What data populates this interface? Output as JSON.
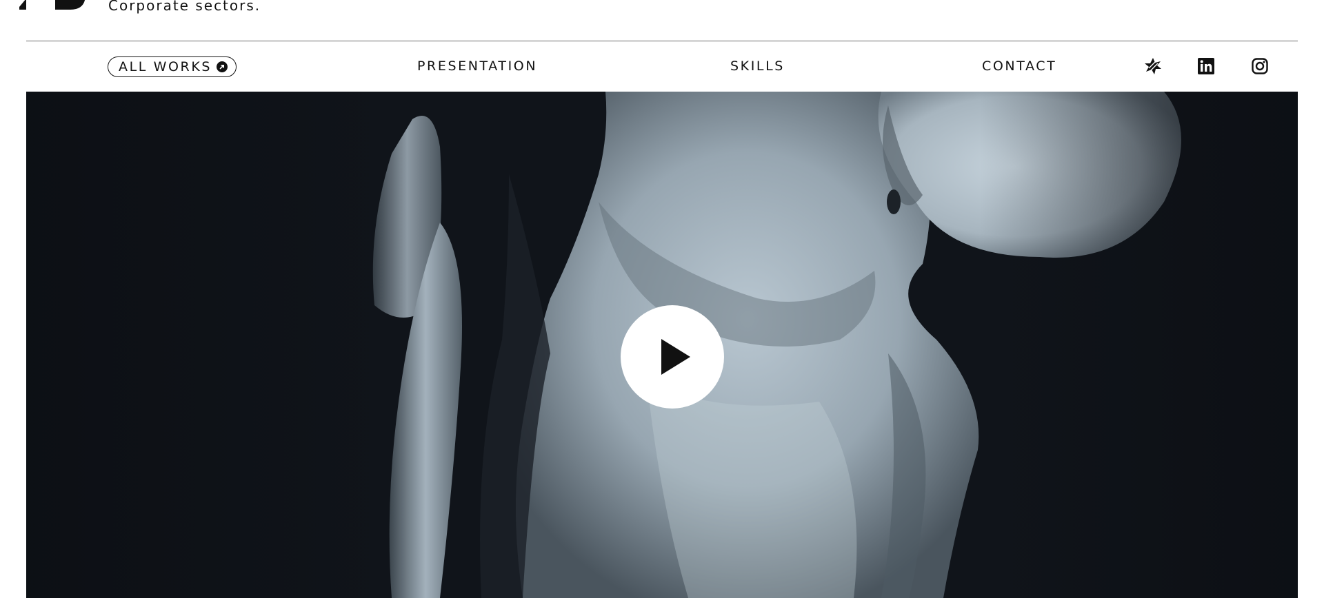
{
  "header": {
    "tagline": "Corporate sectors."
  },
  "nav": {
    "items": [
      {
        "label": "ALL WORKS",
        "icon": "arrow-up-right-circle-icon"
      },
      {
        "label": "PRESENTATION"
      },
      {
        "label": "SKILLS"
      },
      {
        "label": "CONTACT"
      }
    ],
    "social": [
      {
        "icon": "behance-icon"
      },
      {
        "icon": "linkedin-icon"
      },
      {
        "icon": "instagram-icon"
      }
    ]
  },
  "hero": {
    "media": "video",
    "play_icon": "play-icon"
  },
  "colors": {
    "text": "#111111",
    "background": "#ffffff",
    "hero_dark": "#0f1218",
    "statue_light": "#a9b6c0"
  }
}
